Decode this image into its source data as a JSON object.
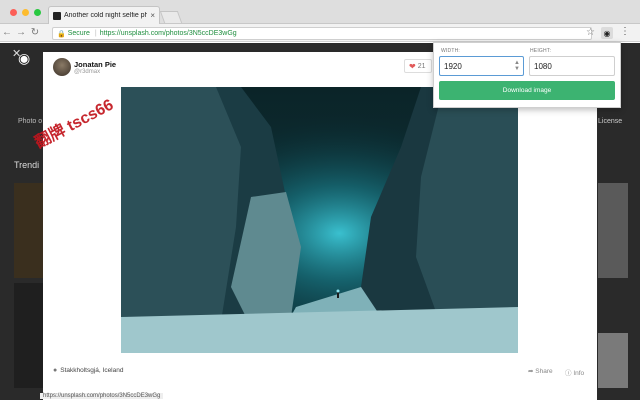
{
  "browser": {
    "tab_title": "Another cold night selfie photo",
    "tab_close": "×",
    "secure_label": "Secure",
    "url": "https://unsplash.com/photos/3N5ccDE3wGg"
  },
  "backdrop": {
    "trending_label": "Trendi",
    "left_text": "Photo o",
    "right_text": "License"
  },
  "modal": {
    "author_name": "Jonatan Pie",
    "author_handle": "@r3dmax",
    "like_count": "21",
    "location": "Stakkholtsgjá, Iceland",
    "share_label": "Share",
    "info_label": "Info"
  },
  "status_bar": "https://unsplash.com/photos/3N5ccDE3wGg",
  "popup": {
    "width_label": "WIDTH:",
    "height_label": "HEIGHT:",
    "width_value": "1920",
    "height_value": "1080",
    "download_label": "Download image"
  },
  "watermark": "翻牌 tscs66",
  "colors": {
    "accent_green": "#3cb371",
    "input_focus": "#5b9bd5",
    "heart": "#e25a5a"
  },
  "icons": [
    "close-icon",
    "camera-icon",
    "lock-icon",
    "star-icon",
    "kebab-icon",
    "heart-icon",
    "pin-icon",
    "share-icon",
    "info-icon"
  ]
}
